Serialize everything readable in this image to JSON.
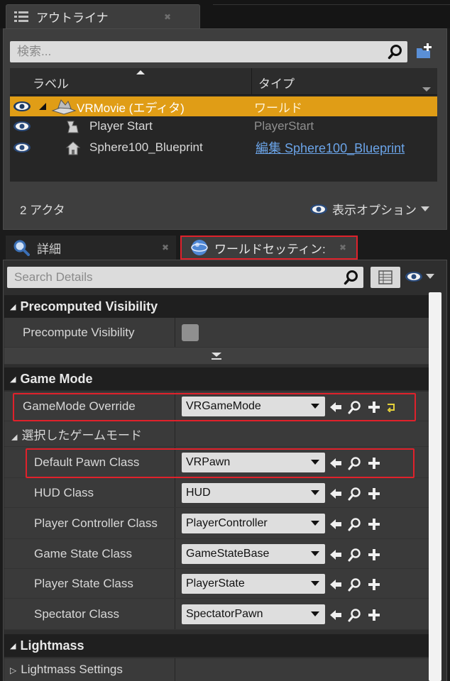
{
  "outliner": {
    "tab_label": "アウトライナ",
    "search_placeholder": "検索...",
    "columns": {
      "label": "ラベル",
      "type": "タイプ"
    },
    "rows": [
      {
        "name": "VRMovie (エディタ)",
        "type": "ワールド",
        "selected": true
      },
      {
        "name": "Player Start",
        "type": "PlayerStart"
      },
      {
        "name": "Sphere100_Blueprint",
        "type": "編集 Sphere100_Blueprint"
      }
    ],
    "actor_count": "2 アクタ",
    "view_options": "表示オプション"
  },
  "details": {
    "tab_details": "詳細",
    "tab_world_settings": "ワールドセッティン:",
    "search_placeholder": "Search Details",
    "categories": {
      "precomputed": "Precomputed Visibility",
      "game_mode": "Game Mode",
      "lightmass": "Lightmass"
    },
    "precompute_visibility": "Precompute Visibility",
    "gamemode_override": {
      "label": "GameMode Override",
      "value": "VRGameMode"
    },
    "selected_game_mode": "選択したゲームモード",
    "properties": [
      {
        "label": "Default Pawn Class",
        "value": "VRPawn"
      },
      {
        "label": "HUD Class",
        "value": "HUD"
      },
      {
        "label": "Player Controller Class",
        "value": "PlayerController"
      },
      {
        "label": "Game State Class",
        "value": "GameStateBase"
      },
      {
        "label": "Player State Class",
        "value": "PlayerState"
      },
      {
        "label": "Spectator Class",
        "value": "SpectatorPawn"
      }
    ],
    "lightmass_settings": "Lightmass Settings"
  },
  "colors": {
    "selection": "#e09d16",
    "highlight": "#e0212b",
    "link": "#6ba4e8"
  }
}
